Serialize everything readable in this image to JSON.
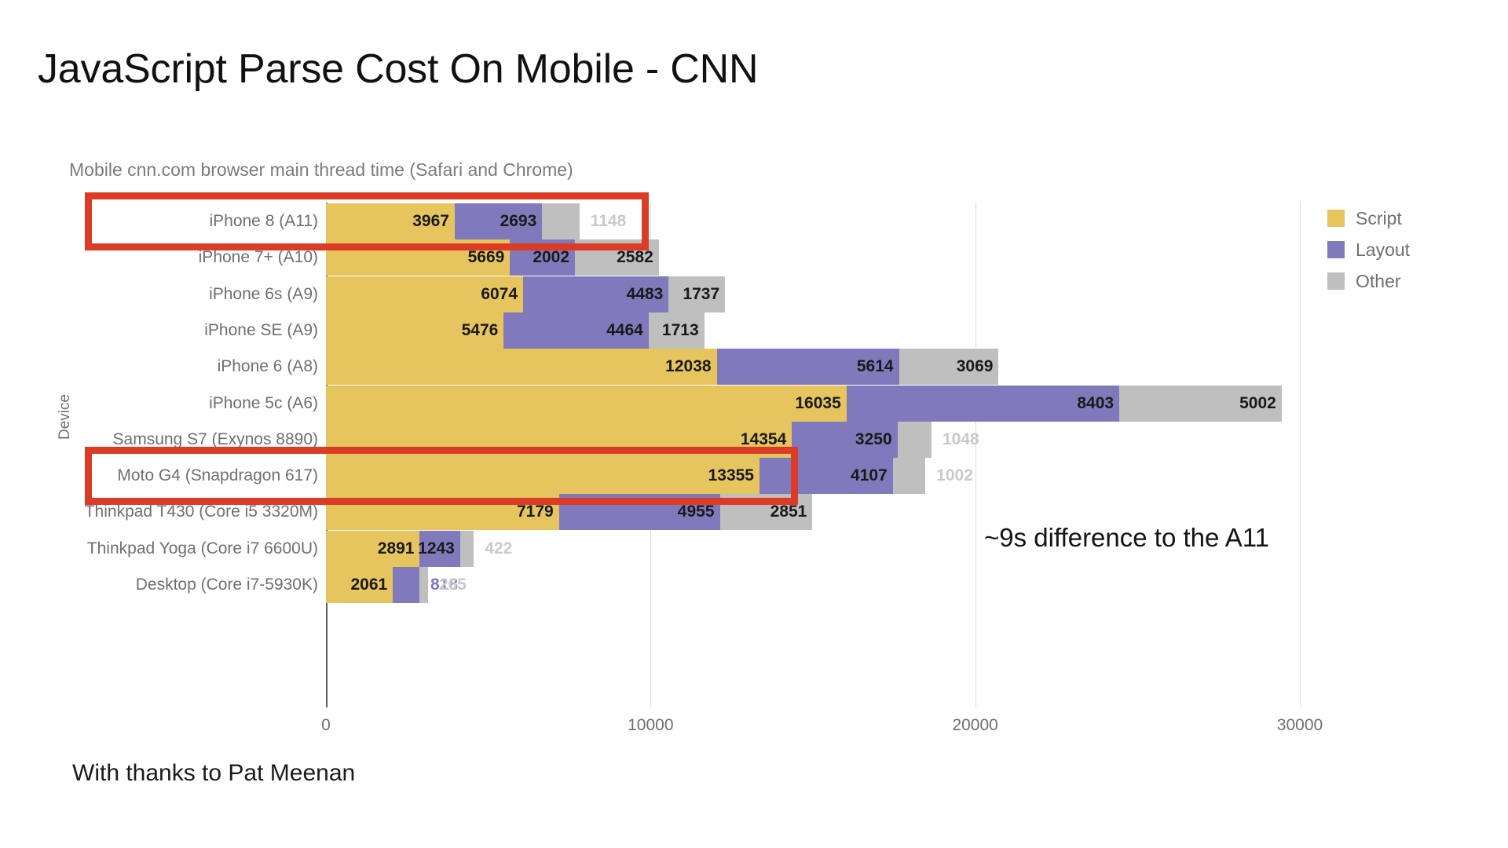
{
  "slide": {
    "title": "JavaScript Parse Cost On Mobile - CNN",
    "footer": "With thanks to Pat Meenan"
  },
  "annotation": {
    "text": "~9s difference to the A11"
  },
  "colors": {
    "script": "#e6c45e",
    "layout": "#8079bc",
    "other": "#bfbfbf",
    "highlight": "#dc3c26",
    "label_muted": "#c9c9c9",
    "axis_text": "#6f6f6f"
  },
  "legend": {
    "position": "right",
    "items": [
      {
        "label": "Script",
        "color": "#e6c45e",
        "swatch": "script-swatch"
      },
      {
        "label": "Layout",
        "color": "#8079bc",
        "swatch": "layout-swatch"
      },
      {
        "label": "Other",
        "color": "#bfbfbf",
        "swatch": "other-swatch"
      }
    ]
  },
  "chart_data": {
    "type": "bar",
    "orientation": "horizontal",
    "stacked": true,
    "title": "Mobile cnn.com browser main thread time (Safari and Chrome)",
    "xlabel": "",
    "ylabel": "Device",
    "xlim": [
      0,
      30000
    ],
    "xticks": [
      0,
      10000,
      20000,
      30000
    ],
    "xtick_labels": [
      "0",
      "10000",
      "20000",
      "30000"
    ],
    "grid": true,
    "legend_position": "right",
    "categories": [
      "iPhone 8 (A11)",
      "iPhone 7+ (A10)",
      "iPhone 6s (A9)",
      "iPhone SE (A9)",
      "iPhone 6 (A8)",
      "iPhone 5c (A6)",
      "Samsung S7 (Exynos 8890)",
      "Moto G4 (Snapdragon 617)",
      "Thinkpad T430 (Core i5 3320M)",
      "Thinkpad Yoga (Core i7 6600U)",
      "Desktop (Core i7-5930K)"
    ],
    "series": [
      {
        "name": "Script",
        "color": "#e6c45e",
        "values": [
          3967,
          5669,
          6074,
          5476,
          12038,
          16035,
          14354,
          13355,
          7179,
          2891,
          2061
        ]
      },
      {
        "name": "Layout",
        "color": "#8079bc",
        "values": [
          2693,
          2002,
          4483,
          4464,
          5614,
          8403,
          3250,
          4107,
          4955,
          1243,
          818
        ]
      },
      {
        "name": "Other",
        "color": "#bfbfbf",
        "values": [
          1148,
          2582,
          1737,
          1713,
          3069,
          5002,
          1048,
          1002,
          2851,
          422,
          265
        ]
      }
    ],
    "rows": [
      {
        "category": "iPhone 8 (A11)",
        "script": 3967,
        "layout": 2693,
        "other": 1148,
        "other_label_outside": true,
        "layout_label_outside": false,
        "highlighted": true
      },
      {
        "category": "iPhone 7+ (A10)",
        "script": 5669,
        "layout": 2002,
        "other": 2582,
        "other_label_outside": false,
        "layout_label_outside": false,
        "highlighted": false
      },
      {
        "category": "iPhone 6s (A9)",
        "script": 6074,
        "layout": 4483,
        "other": 1737,
        "other_label_outside": false,
        "layout_label_outside": false,
        "highlighted": false
      },
      {
        "category": "iPhone SE (A9)",
        "script": 5476,
        "layout": 4464,
        "other": 1713,
        "other_label_outside": false,
        "layout_label_outside": false,
        "highlighted": false
      },
      {
        "category": "iPhone 6 (A8)",
        "script": 12038,
        "layout": 5614,
        "other": 3069,
        "other_label_outside": false,
        "layout_label_outside": false,
        "highlighted": false
      },
      {
        "category": "iPhone 5c (A6)",
        "script": 16035,
        "layout": 8403,
        "other": 5002,
        "other_label_outside": false,
        "layout_label_outside": false,
        "highlighted": false
      },
      {
        "category": "Samsung S7 (Exynos 8890)",
        "script": 14354,
        "layout": 3250,
        "other": 1048,
        "other_label_outside": true,
        "layout_label_outside": false,
        "highlighted": false
      },
      {
        "category": "Moto G4 (Snapdragon 617)",
        "script": 13355,
        "layout": 4107,
        "other": 1002,
        "other_label_outside": true,
        "layout_label_outside": false,
        "highlighted": true
      },
      {
        "category": "Thinkpad T430 (Core i5 3320M)",
        "script": 7179,
        "layout": 4955,
        "other": 2851,
        "other_label_outside": false,
        "layout_label_outside": false,
        "highlighted": false
      },
      {
        "category": "Thinkpad Yoga (Core i7 6600U)",
        "script": 2891,
        "layout": 1243,
        "other": 422,
        "other_label_outside": true,
        "layout_label_outside": false,
        "highlighted": false
      },
      {
        "category": "Desktop (Core i7-5930K)",
        "script": 2061,
        "layout": 818,
        "other": 265,
        "other_label_outside": true,
        "layout_label_outside": true,
        "highlighted": false
      }
    ]
  }
}
